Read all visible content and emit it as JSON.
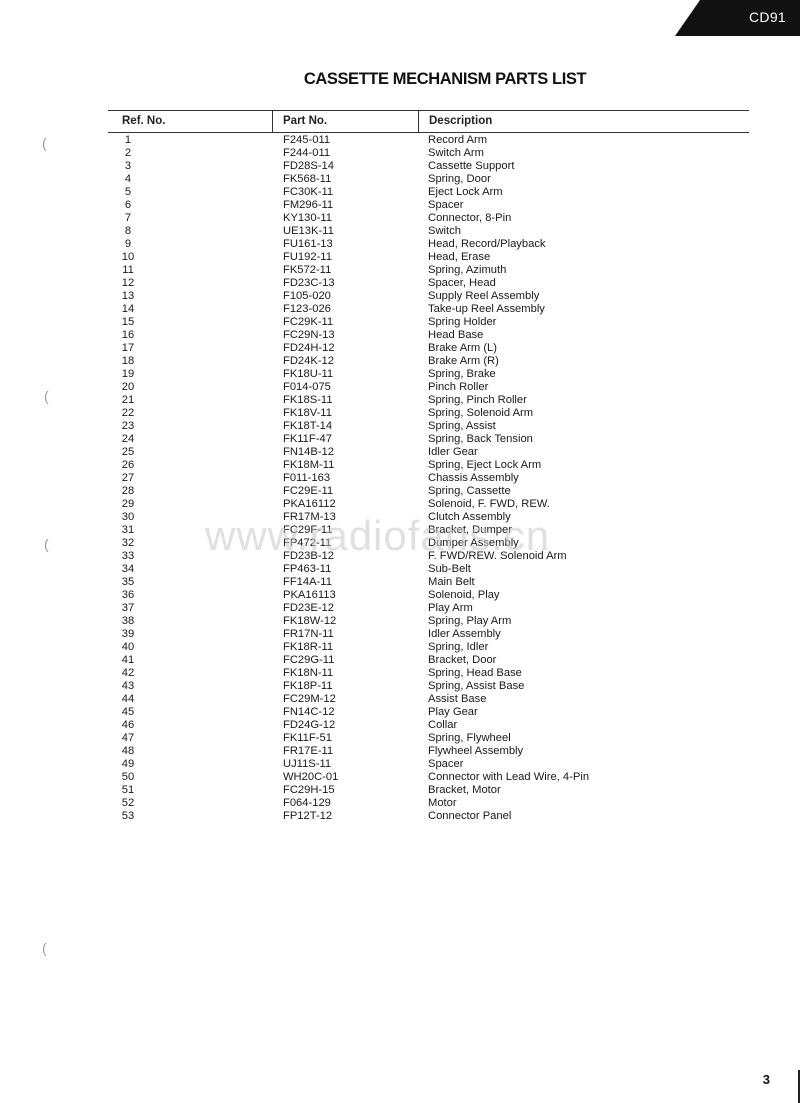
{
  "header": {
    "model": "CD91"
  },
  "title": "CASSETTE MECHANISM PARTS LIST",
  "table": {
    "columns": [
      "Ref. No.",
      "Part No.",
      "Description"
    ],
    "rows": [
      {
        "ref": "1",
        "part": "F245-011",
        "desc": "Record Arm"
      },
      {
        "ref": "2",
        "part": "F244-011",
        "desc": "Switch Arm"
      },
      {
        "ref": "3",
        "part": "FD28S-14",
        "desc": "Cassette Support"
      },
      {
        "ref": "4",
        "part": "FK568-11",
        "desc": "Spring, Door"
      },
      {
        "ref": "5",
        "part": "FC30K-11",
        "desc": "Eject Lock Arm"
      },
      {
        "ref": "6",
        "part": "FM296-11",
        "desc": "Spacer"
      },
      {
        "ref": "7",
        "part": "KY130-11",
        "desc": "Connector, 8-Pin"
      },
      {
        "ref": "8",
        "part": "UE13K-11",
        "desc": "Switch"
      },
      {
        "ref": "9",
        "part": "FU161-13",
        "desc": "Head, Record/Playback"
      },
      {
        "ref": "10",
        "part": "FU192-11",
        "desc": "Head, Erase"
      },
      {
        "ref": "11",
        "part": "FK572-11",
        "desc": "Spring, Azimuth"
      },
      {
        "ref": "12",
        "part": "FD23C-13",
        "desc": "Spacer, Head"
      },
      {
        "ref": "13",
        "part": "F105-020",
        "desc": "Supply Reel Assembly"
      },
      {
        "ref": "14",
        "part": "F123-026",
        "desc": "Take-up Reel Assembly"
      },
      {
        "ref": "15",
        "part": "FC29K-11",
        "desc": "Spring Holder"
      },
      {
        "ref": "16",
        "part": "FC29N-13",
        "desc": "Head Base"
      },
      {
        "ref": "17",
        "part": "FD24H-12",
        "desc": "Brake Arm (L)"
      },
      {
        "ref": "18",
        "part": "FD24K-12",
        "desc": "Brake Arm (R)"
      },
      {
        "ref": "19",
        "part": "FK18U-11",
        "desc": "Spring, Brake"
      },
      {
        "ref": "20",
        "part": "F014-075",
        "desc": "Pinch Roller"
      },
      {
        "ref": "21",
        "part": "FK18S-11",
        "desc": "Spring, Pinch Roller"
      },
      {
        "ref": "22",
        "part": "FK18V-11",
        "desc": "Spring, Solenoid Arm"
      },
      {
        "ref": "23",
        "part": "FK18T-14",
        "desc": "Spring, Assist"
      },
      {
        "ref": "24",
        "part": "FK11F-47",
        "desc": "Spring, Back Tension"
      },
      {
        "ref": "25",
        "part": "FN14B-12",
        "desc": "Idler Gear"
      },
      {
        "ref": "26",
        "part": "FK18M-11",
        "desc": "Spring, Eject Lock Arm"
      },
      {
        "ref": "27",
        "part": "F011-163",
        "desc": "Chassis Assembly"
      },
      {
        "ref": "28",
        "part": "FC29E-11",
        "desc": "Spring, Cassette"
      },
      {
        "ref": "29",
        "part": "PKA16112",
        "desc": "Solenoid, F. FWD, REW."
      },
      {
        "ref": "30",
        "part": "FR17M-13",
        "desc": "Clutch Assembly"
      },
      {
        "ref": "31",
        "part": "FC29F-11",
        "desc": "Bracket, Dumper"
      },
      {
        "ref": "32",
        "part": "FP472-11",
        "desc": "Dumper Assembly"
      },
      {
        "ref": "33",
        "part": "FD23B-12",
        "desc": "F. FWD/REW. Solenoid Arm"
      },
      {
        "ref": "34",
        "part": "FP463-11",
        "desc": "Sub-Belt"
      },
      {
        "ref": "35",
        "part": "FF14A-11",
        "desc": "Main Belt"
      },
      {
        "ref": "36",
        "part": "PKA16113",
        "desc": "Solenoid, Play"
      },
      {
        "ref": "37",
        "part": "FD23E-12",
        "desc": "Play Arm"
      },
      {
        "ref": "38",
        "part": "FK18W-12",
        "desc": "Spring, Play Arm"
      },
      {
        "ref": "39",
        "part": "FR17N-11",
        "desc": "Idler Assembly"
      },
      {
        "ref": "40",
        "part": "FK18R-11",
        "desc": "Spring, Idler"
      },
      {
        "ref": "41",
        "part": "FC29G-11",
        "desc": "Bracket, Door"
      },
      {
        "ref": "42",
        "part": "FK18N-11",
        "desc": "Spring, Head Base"
      },
      {
        "ref": "43",
        "part": "FK18P-11",
        "desc": "Spring, Assist Base"
      },
      {
        "ref": "44",
        "part": "FC29M-12",
        "desc": "Assist Base"
      },
      {
        "ref": "45",
        "part": "FN14C-12",
        "desc": "Play Gear"
      },
      {
        "ref": "46",
        "part": "FD24G-12",
        "desc": "Collar"
      },
      {
        "ref": "47",
        "part": "FK11F-51",
        "desc": "Spring, Flywheel"
      },
      {
        "ref": "48",
        "part": "FR17E-11",
        "desc": "Flywheel Assembly"
      },
      {
        "ref": "49",
        "part": "UJ11S-11",
        "desc": "Spacer"
      },
      {
        "ref": "50",
        "part": "WH20C-01",
        "desc": "Connector with Lead Wire, 4-Pin"
      },
      {
        "ref": "51",
        "part": "FC29H-15",
        "desc": "Bracket, Motor"
      },
      {
        "ref": "52",
        "part": "F064-129",
        "desc": "Motor"
      },
      {
        "ref": "53",
        "part": "FP12T-12",
        "desc": "Connector Panel"
      }
    ]
  },
  "watermark": "www.radiofans.cn",
  "page_number": "3"
}
